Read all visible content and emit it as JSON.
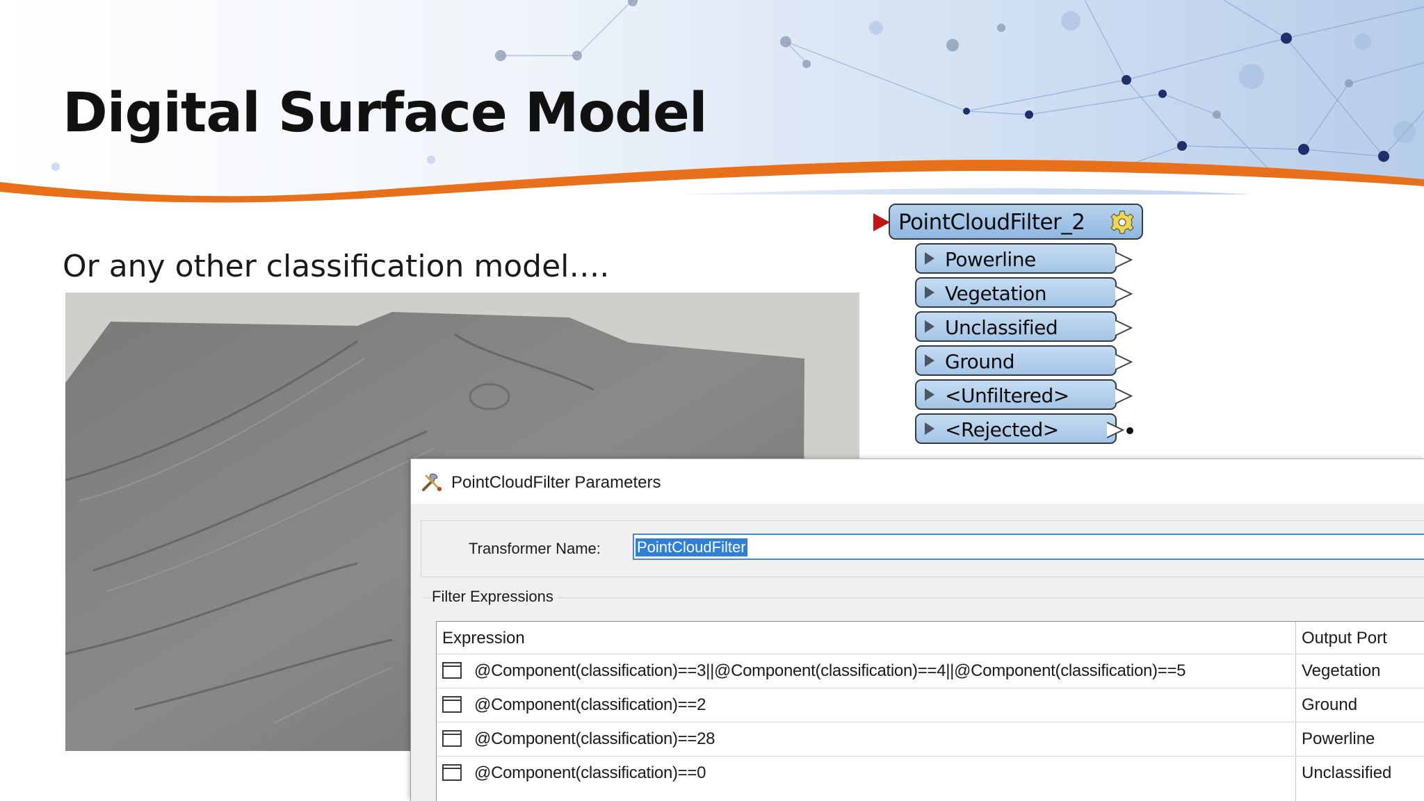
{
  "slide": {
    "title": "Digital Surface Model",
    "subtitle": "Or any other classification model…."
  },
  "transformer": {
    "name": "PointCloudFilter_2",
    "ports": [
      "Powerline",
      "Vegetation",
      "Unclassified",
      "Ground",
      "<Unfiltered>",
      "<Rejected>"
    ],
    "icon": "gear-icon"
  },
  "dialog": {
    "title": "PointCloudFilter Parameters",
    "transformer_name_label": "Transformer Name:",
    "transformer_name_value": "PointCloudFilter",
    "filter_group_label": "Filter Expressions",
    "columns": [
      "Expression",
      "Output Port"
    ],
    "rows": [
      {
        "expression": "@Component(classification)==3||@Component(classification)==4||@Component(classification)==5",
        "output_port": "Vegetation"
      },
      {
        "expression": "@Component(classification)==2",
        "output_port": "Ground"
      },
      {
        "expression": "@Component(classification)==28",
        "output_port": "Powerline"
      },
      {
        "expression": "@Component(classification)==0",
        "output_port": "Unclassified"
      }
    ]
  },
  "colors": {
    "accent_orange": "#e8701a",
    "node_blue": "#a3c5e6",
    "selection_blue": "#2f7fd8",
    "input_arrow_red": "#c01616"
  }
}
